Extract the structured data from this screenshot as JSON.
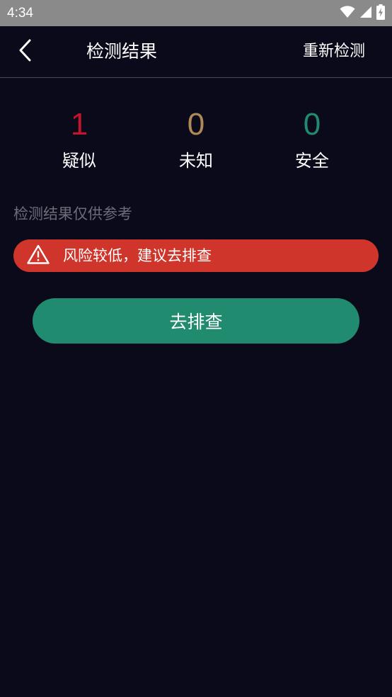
{
  "status_bar": {
    "time": "4:34",
    "icons": [
      "wifi-icon",
      "signal-icon",
      "battery-charging-icon"
    ]
  },
  "header": {
    "title": "检测结果",
    "back_icon": "chevron-left-icon",
    "retest_label": "重新检测"
  },
  "stats": [
    {
      "value": "1",
      "label": "疑似",
      "color": "#c0152a"
    },
    {
      "value": "0",
      "label": "未知",
      "color": "#b08a55"
    },
    {
      "value": "0",
      "label": "安全",
      "color": "#208b6e"
    }
  ],
  "disclaimer": "检测结果仅供参考",
  "alert": {
    "icon": "warning-triangle-icon",
    "text": "风险较低，建议去排查",
    "color": "#cf352b"
  },
  "action": {
    "label": "去排查",
    "color": "#208b6e"
  }
}
